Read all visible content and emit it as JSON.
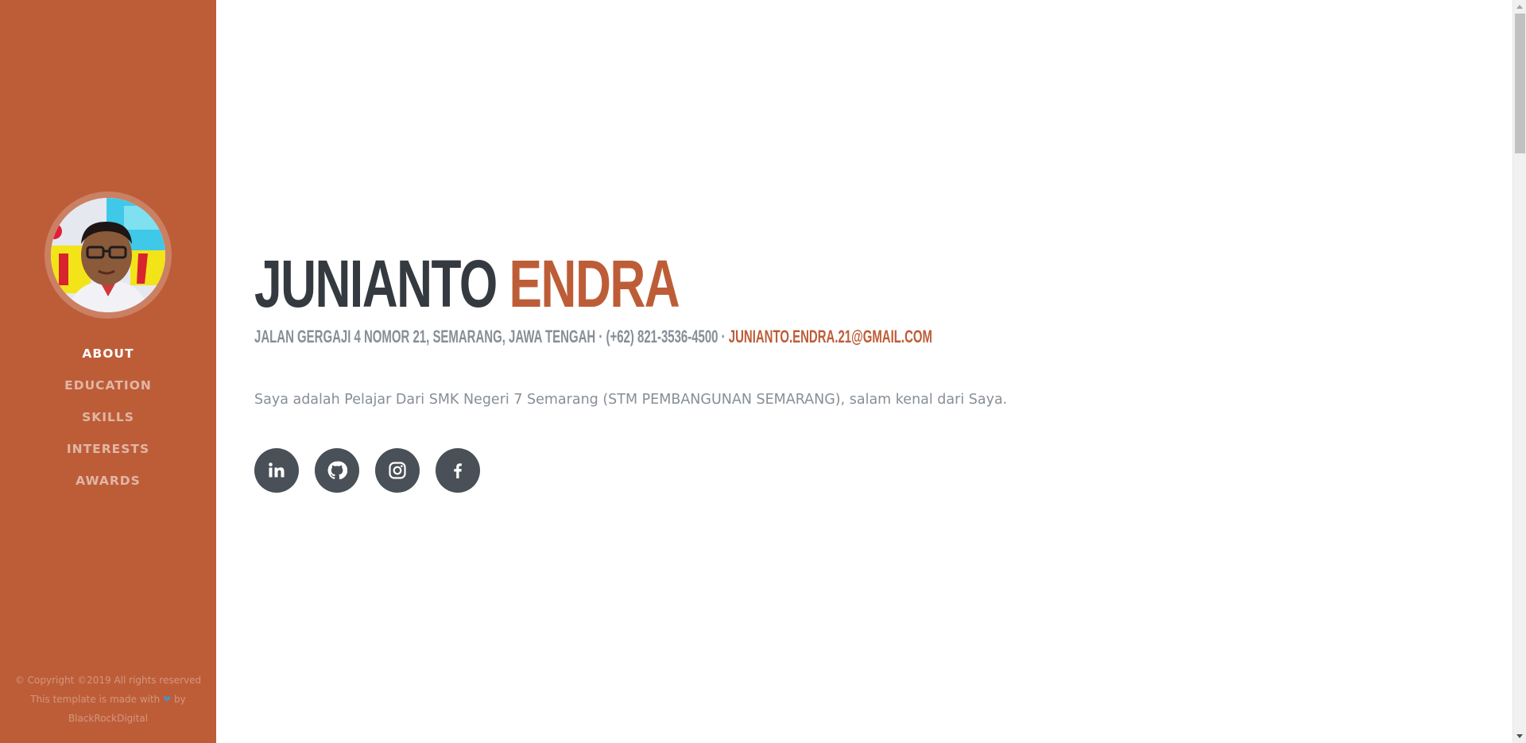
{
  "nav": {
    "items": [
      {
        "label": "ABOUT",
        "active": true
      },
      {
        "label": "EDUCATION",
        "active": false
      },
      {
        "label": "SKILLS",
        "active": false
      },
      {
        "label": "INTERESTS",
        "active": false
      },
      {
        "label": "AWARDS",
        "active": false
      }
    ]
  },
  "footer": {
    "copyright": "© Copyright ©2019 All rights reserved",
    "made_with_prefix": "This template is made with",
    "heart_icon": "heart-icon",
    "made_with_suffix": "by",
    "author": "BlackRockDigital"
  },
  "profile": {
    "first_name": "JUNIANTO",
    "last_name": "ENDRA",
    "address": "JALAN GERGAJI 4 NOMOR 21, SEMARANG, JAWA TENGAH",
    "separator": " · ",
    "phone": "(+62) 821-3536-4500",
    "email": "JUNIANTO.ENDRA.21@GMAIL.COM",
    "bio": "Saya adalah Pelajar Dari SMK Negeri 7 Semarang (STM PEMBANGUNAN SEMARANG), salam kenal dari Saya."
  },
  "social": [
    {
      "name": "linkedin",
      "icon": "linkedin-icon"
    },
    {
      "name": "github",
      "icon": "github-icon"
    },
    {
      "name": "instagram",
      "icon": "instagram-icon"
    },
    {
      "name": "facebook",
      "icon": "facebook-icon"
    }
  ],
  "colors": {
    "sidebar_bg": "#bd5d38",
    "accent": "#bd5d38",
    "heading": "#343a40",
    "muted_text": "#868e96",
    "social_button": "#495057"
  }
}
